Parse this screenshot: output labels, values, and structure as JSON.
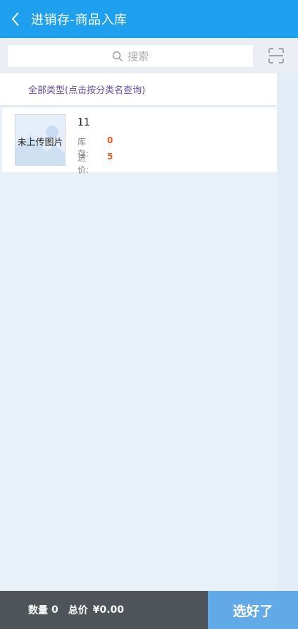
{
  "header": {
    "title": "进销存-商品入库"
  },
  "search": {
    "placeholder": "搜索"
  },
  "category": {
    "label": "全部类型(点击按分类名查询)"
  },
  "products": [
    {
      "name": "11",
      "image_placeholder": "未上传图片",
      "stock_label": "库　　存:",
      "stock_value": "0",
      "price_label": "进　　价:",
      "price_value": "5"
    }
  ],
  "footer": {
    "quantity_label": "数量",
    "quantity_value": "0",
    "total_label": "总价",
    "total_value": "¥0.00",
    "confirm_label": "选好了"
  },
  "colors": {
    "header_bg": "#1fa0ee",
    "accent_value": "#f05a28",
    "footer_dark": "#4e5459",
    "confirm_bg": "#62a9e8"
  },
  "icons": [
    "back-icon",
    "search-icon",
    "scan-icon",
    "image-placeholder-icon"
  ]
}
